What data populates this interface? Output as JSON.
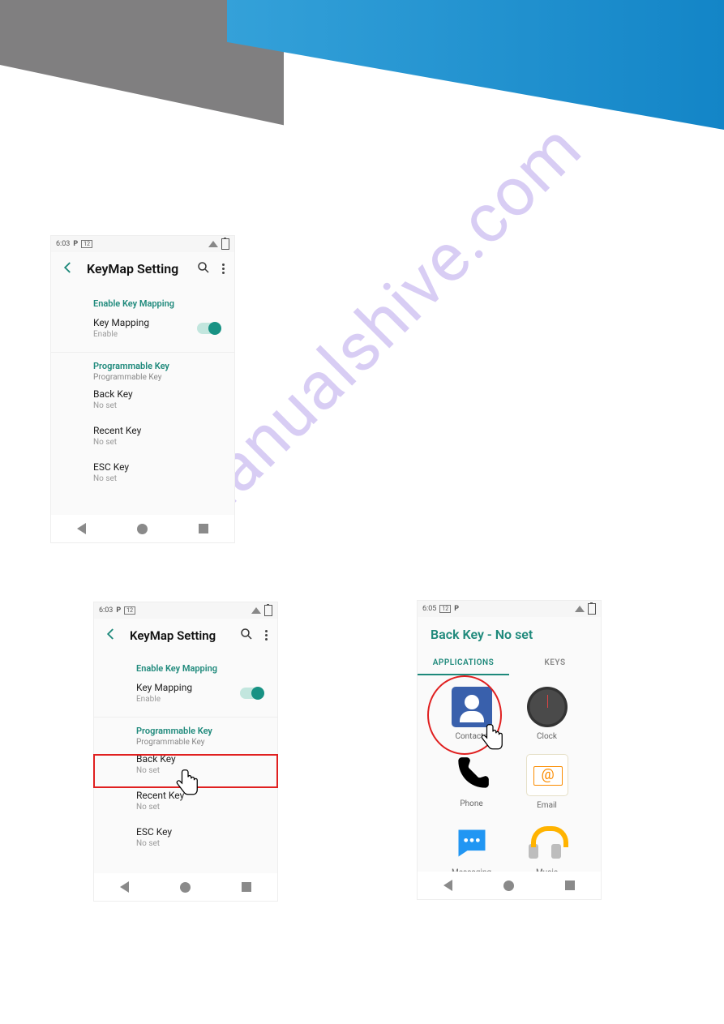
{
  "watermark": "manualshive.com",
  "screen1": {
    "status": {
      "time": "6:03"
    },
    "appbar": {
      "title": "KeyMap Setting"
    },
    "enable_section": "Enable Key Mapping",
    "keymapping": {
      "title": "Key Mapping",
      "sub": "Enable"
    },
    "prog_section": "Programmable Key",
    "prog_sub": "Programmable Key",
    "items": [
      {
        "title": "Back Key",
        "sub": "No set"
      },
      {
        "title": "Recent Key",
        "sub": "No set"
      },
      {
        "title": "ESC Key",
        "sub": "No set"
      }
    ]
  },
  "screen2": {
    "status": {
      "time": "6:03"
    },
    "appbar": {
      "title": "KeyMap Setting"
    },
    "enable_section": "Enable Key Mapping",
    "keymapping": {
      "title": "Key Mapping",
      "sub": "Enable"
    },
    "prog_section": "Programmable Key",
    "prog_sub": "Programmable Key",
    "items": [
      {
        "title": "Back Key",
        "sub": "No set"
      },
      {
        "title": "Recent Key",
        "sub": "No set"
      },
      {
        "title": "ESC Key",
        "sub": "No set"
      }
    ]
  },
  "screen3": {
    "status": {
      "time": "6:05"
    },
    "title": "Back Key - No set",
    "tabs": {
      "apps": "APPLICATIONS",
      "keys": "KEYS"
    },
    "apps": [
      {
        "label": "Contacts"
      },
      {
        "label": "Clock"
      },
      {
        "label": "Phone"
      },
      {
        "label": "Email"
      },
      {
        "label": "Messaging"
      },
      {
        "label": "Music"
      }
    ]
  }
}
